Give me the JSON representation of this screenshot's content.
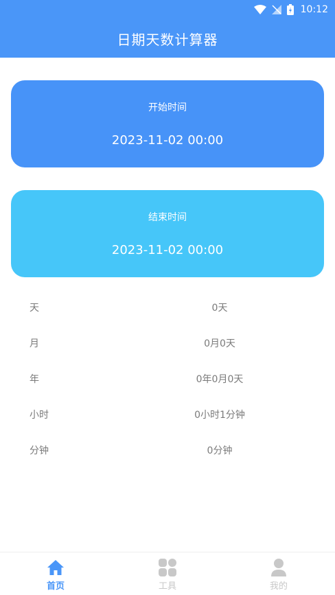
{
  "status_bar": {
    "time": "10:12"
  },
  "header": {
    "title": "日期天数计算器"
  },
  "start_card": {
    "label": "开始时间",
    "value": "2023-11-02 00:00"
  },
  "end_card": {
    "label": "结束时间",
    "value": "2023-11-02 00:00"
  },
  "results": [
    {
      "name": "天",
      "value": "0天"
    },
    {
      "name": "月",
      "value": "0月0天"
    },
    {
      "name": "年",
      "value": "0年0月0天"
    },
    {
      "name": "小时",
      "value": "0小时1分钟"
    },
    {
      "name": "分钟",
      "value": "0分钟"
    }
  ],
  "tabs": [
    {
      "label": "首页",
      "icon": "home-icon",
      "active": true
    },
    {
      "label": "工具",
      "icon": "grid-icon",
      "active": false
    },
    {
      "label": "我的",
      "icon": "user-icon",
      "active": false
    }
  ],
  "colors": {
    "header": "#4a96f8",
    "start_card": "#4793f8",
    "end_card": "#46c6f9",
    "inactive_tab": "#c8c8c8"
  }
}
